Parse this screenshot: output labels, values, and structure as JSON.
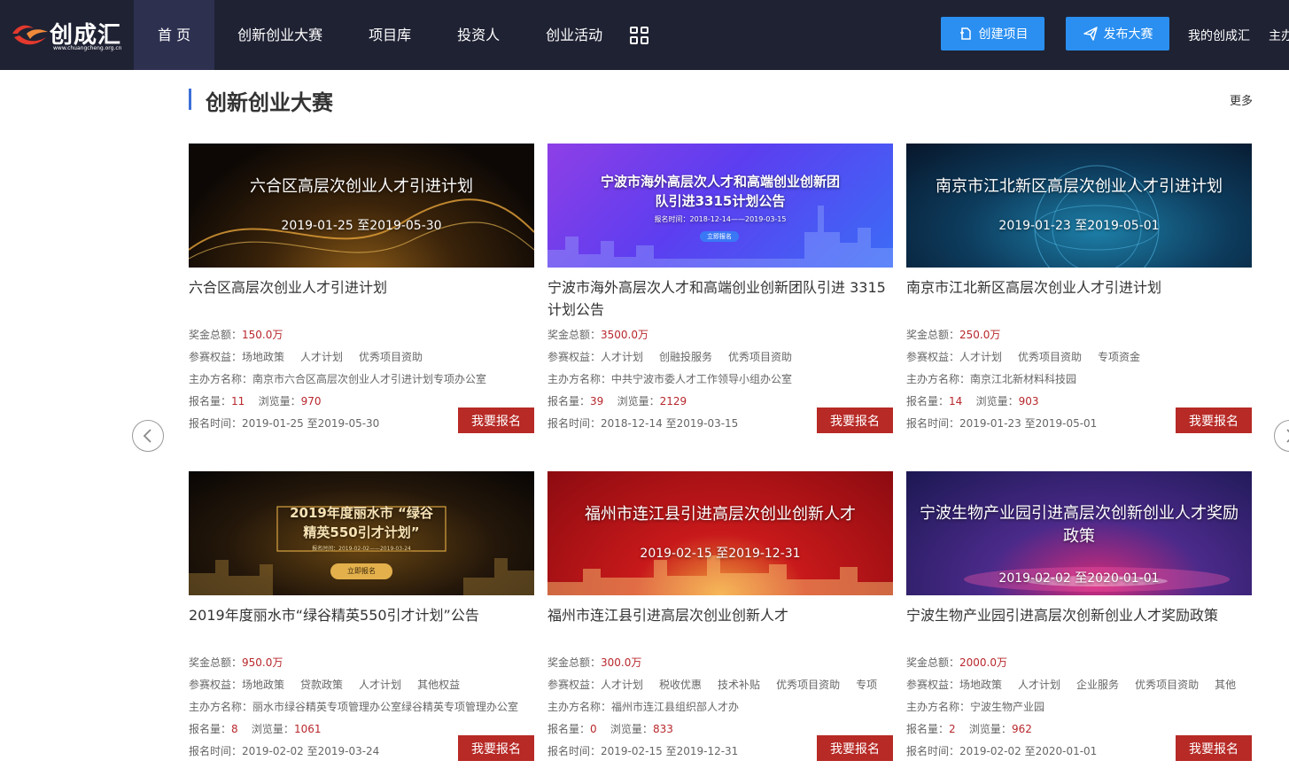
{
  "header": {
    "logo_text": "创成汇",
    "logo_sub": "www.chuangcheng.org.cn",
    "nav": [
      {
        "label": "首 页"
      },
      {
        "label": "创新创业大赛"
      },
      {
        "label": "项目库"
      },
      {
        "label": "投资人"
      },
      {
        "label": "创业活动"
      }
    ],
    "create_project": "创建项目",
    "publish_contest": "发布大赛",
    "my_account": "我的创成汇",
    "host": "主办"
  },
  "section": {
    "title": "创新创业大赛",
    "more": "更多"
  },
  "labels": {
    "prize": "奖金总额：",
    "rights": "参赛权益：",
    "host": "主办方名称：",
    "signups": "报名量：",
    "views": "浏览量：",
    "period": "报名时间：",
    "sign_up_button": "我要报名"
  },
  "cards": [
    {
      "banner_title": "六合区高层次创业人才引进计划",
      "banner_date": "2019-01-25 至2019-05-30",
      "title": "六合区高层次创业人才引进计划",
      "prize": "150.0万",
      "rights": [
        "场地政策",
        "人才计划",
        "优秀项目资助"
      ],
      "host": "南京市六合区高层次创业人才引进计划专项办公室",
      "signups": "11",
      "views": "970",
      "period": "2019-01-25 至2019-05-30"
    },
    {
      "banner_title": "宁波市海外高层次人才和高端创业创新团队引进3315计划公告",
      "banner_date": "报名时间：2018-12-14——2019-03-15",
      "banner_button": "立即报名",
      "title": "宁波市海外高层次人才和高端创业创新团队引进 3315计划公告",
      "prize": "3500.0万",
      "rights": [
        "人才计划",
        "创融投服务",
        "优秀项目资助"
      ],
      "host": "中共宁波市委人才工作领导小组办公室",
      "signups": "39",
      "views": "2129",
      "period": "2018-12-14 至2019-03-15"
    },
    {
      "banner_title": "南京市江北新区高层次创业人才引进计划",
      "banner_date": "2019-01-23 至2019-05-01",
      "title": "南京市江北新区高层次创业人才引进计划",
      "prize": "250.0万",
      "rights": [
        "人才计划",
        "优秀项目资助",
        "专项资金"
      ],
      "host": "南京江北新材料科技园",
      "signups": "14",
      "views": "903",
      "period": "2019-01-23 至2019-05-01"
    },
    {
      "banner_title": "2019年度丽水市 “绿谷精英550引才计划”",
      "banner_date": "报名时间：2019-02-02——2019-03-24",
      "banner_button": "立即报名",
      "title": "2019年度丽水市“绿谷精英550引才计划”公告",
      "prize": "950.0万",
      "rights": [
        "场地政策",
        "贷款政策",
        "人才计划",
        "其他权益"
      ],
      "host": "丽水市绿谷精英专项管理办公室绿谷精英专项管理办公室",
      "signups": "8",
      "views": "1061",
      "period": "2019-02-02 至2019-03-24"
    },
    {
      "banner_title": "福州市连江县引进高层次创业创新人才",
      "banner_date": "2019-02-15 至2019-12-31",
      "title": "福州市连江县引进高层次创业创新人才",
      "prize": "300.0万",
      "rights": [
        "人才计划",
        "税收优惠",
        "技术补贴",
        "优秀项目资助",
        "专项"
      ],
      "host": "福州市连江县组织部人才办",
      "signups": "0",
      "views": "833",
      "period": "2019-02-15 至2019-12-31"
    },
    {
      "banner_title": "宁波生物产业园引进高层次创新创业人才奖励政策",
      "banner_date": "2019-02-02 至2020-01-01",
      "title": "宁波生物产业园引进高层次创新创业人才奖励政策",
      "prize": "2000.0万",
      "rights": [
        "场地政策",
        "人才计划",
        "企业服务",
        "优秀项目资助",
        "其他"
      ],
      "host": "宁波生物产业园",
      "signups": "2",
      "views": "962",
      "period": "2019-02-02 至2020-01-01"
    }
  ]
}
